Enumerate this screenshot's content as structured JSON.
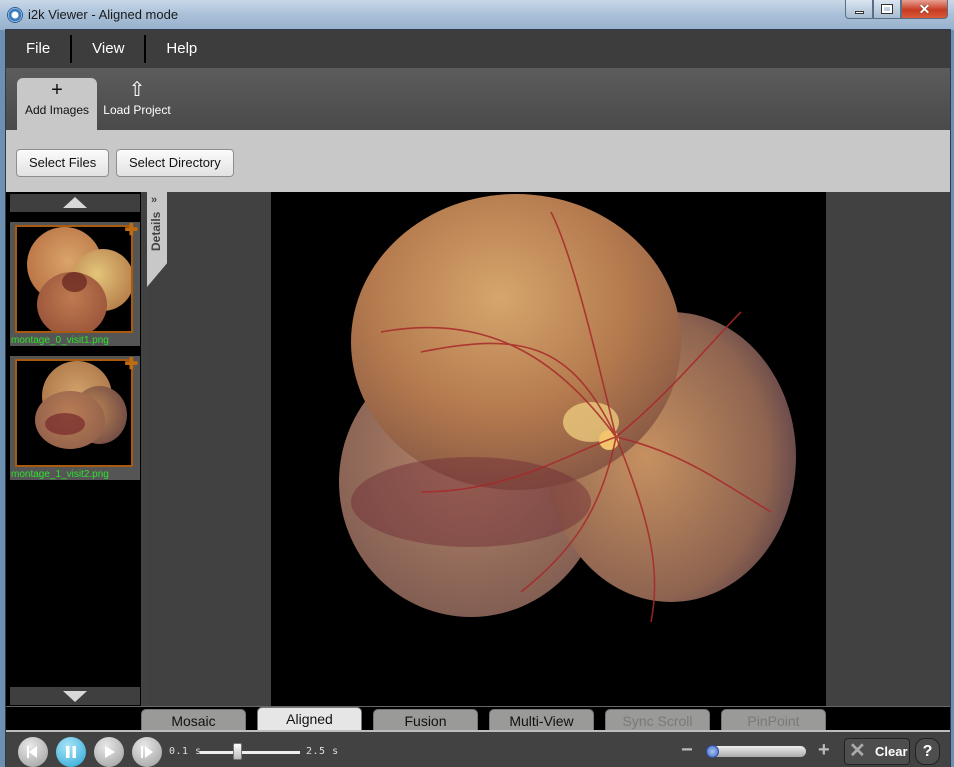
{
  "window": {
    "title": "i2k Viewer - Aligned mode",
    "controls": {
      "minimize": "minimize",
      "maximize": "maximize",
      "close": "close"
    }
  },
  "menu": {
    "items": [
      {
        "label": "File"
      },
      {
        "label": "View"
      },
      {
        "label": "Help"
      }
    ]
  },
  "ribbon": {
    "tabs": [
      {
        "label": "Add Images",
        "icon": "plus-icon",
        "glyph": "+",
        "active": true
      },
      {
        "label": "Load Project",
        "icon": "upload-arrow-icon",
        "glyph": "⇧",
        "active": false
      }
    ]
  },
  "toolbar": {
    "select_files": "Select Files",
    "select_directory": "Select Directory"
  },
  "thumbnails": {
    "items": [
      {
        "name": "montage_0_visit1.png",
        "add_glyph": "✚"
      },
      {
        "name": "montage_1_visit2.png",
        "add_glyph": "✚"
      }
    ]
  },
  "details": {
    "label": "Details",
    "chevron": "»"
  },
  "mode_tabs": [
    {
      "label": "Mosaic",
      "state": "normal"
    },
    {
      "label": "Aligned",
      "state": "active"
    },
    {
      "label": "Fusion",
      "state": "normal"
    },
    {
      "label": "Multi-View",
      "state": "normal"
    },
    {
      "label": "Sync Scroll",
      "state": "disabled"
    },
    {
      "label": "PinPoint",
      "state": "disabled"
    }
  ],
  "playback": {
    "speed_min": "0.1 s",
    "speed_max": "2.5 s",
    "speed_fraction": 0.38,
    "playing": true
  },
  "zoom": {
    "minus": "−",
    "plus": "+",
    "fraction": 0.0
  },
  "actions": {
    "clear": "Clear",
    "clear_glyph": "✕",
    "help": "?"
  },
  "colors": {
    "accent_active_play": "#2aa7d8",
    "thumbnail_border": "#a85a10",
    "thumbnail_label": "#2ee02e"
  }
}
